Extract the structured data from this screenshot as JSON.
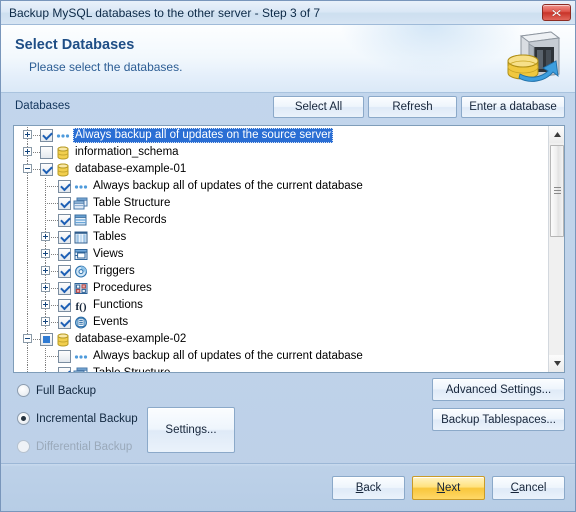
{
  "window": {
    "title": "Backup MySQL databases to the other server - Step 3 of 7",
    "close_icon": "close-icon"
  },
  "header": {
    "title": "Select Databases",
    "subtitle": "Please select the databases.",
    "icon": "database-backup-icon"
  },
  "toolbar": {
    "databases_label": "Databases",
    "select_all_label": "Select All",
    "refresh_label": "Refresh",
    "enter_database_label": "Enter a database"
  },
  "tree": {
    "rows": [
      {
        "label": "Always backup all of updates on the source server",
        "indent": 0,
        "expander": "plus",
        "check": "checked",
        "icon": "dots-icon",
        "selected": true
      },
      {
        "label": "information_schema",
        "indent": 0,
        "expander": "plus",
        "check": "unchecked",
        "icon": "database-icon",
        "selected": false
      },
      {
        "label": "database-example-01",
        "indent": 0,
        "expander": "minus",
        "check": "checked",
        "icon": "database-icon",
        "selected": false
      },
      {
        "label": "Always backup all of updates of the current database",
        "indent": 1,
        "expander": "none",
        "check": "checked",
        "icon": "dots-icon",
        "selected": false
      },
      {
        "label": "Table Structure",
        "indent": 1,
        "expander": "none",
        "check": "checked",
        "icon": "table-structure-icon",
        "selected": false
      },
      {
        "label": "Table Records",
        "indent": 1,
        "expander": "none",
        "check": "checked",
        "icon": "table-records-icon",
        "selected": false
      },
      {
        "label": "Tables",
        "indent": 1,
        "expander": "plus",
        "check": "checked",
        "icon": "tables-icon",
        "selected": false
      },
      {
        "label": "Views",
        "indent": 1,
        "expander": "plus",
        "check": "checked",
        "icon": "views-icon",
        "selected": false
      },
      {
        "label": "Triggers",
        "indent": 1,
        "expander": "plus",
        "check": "checked",
        "icon": "triggers-icon",
        "selected": false
      },
      {
        "label": "Procedures",
        "indent": 1,
        "expander": "plus",
        "check": "checked",
        "icon": "procedures-icon",
        "selected": false
      },
      {
        "label": "Functions",
        "indent": 1,
        "expander": "plus",
        "check": "checked",
        "icon": "functions-icon",
        "selected": false
      },
      {
        "label": "Events",
        "indent": 1,
        "expander": "plus",
        "check": "checked",
        "icon": "events-icon",
        "selected": false
      },
      {
        "label": "database-example-02",
        "indent": 0,
        "expander": "minus",
        "check": "partial",
        "icon": "database-icon",
        "selected": false
      },
      {
        "label": "Always backup all of updates of the current database",
        "indent": 1,
        "expander": "none",
        "check": "unchecked",
        "icon": "dots-icon",
        "selected": false
      },
      {
        "label": "Table Structure",
        "indent": 1,
        "expander": "none",
        "check": "checked",
        "icon": "table-structure-icon",
        "selected": false
      }
    ],
    "scrollbar": {
      "up_icon": "scroll-up-arrow-icon",
      "down_icon": "scroll-down-arrow-icon"
    }
  },
  "options": {
    "full_backup_label": "Full Backup",
    "incremental_backup_label": "Incremental Backup",
    "differential_backup_label": "Differential Backup",
    "selected": "Incremental Backup",
    "settings_label": "Settings...",
    "advanced_settings_label": "Advanced Settings...",
    "backup_tablespaces_label": "Backup Tablespaces..."
  },
  "footer": {
    "back_label": "Back",
    "back_accel": "B",
    "next_label": "Next",
    "next_accel": "N",
    "cancel_label": "Cancel",
    "cancel_accel": "C"
  },
  "colors": {
    "selection_blue": "#2a6ed4",
    "next_accent": "#f8c63c",
    "close_red": "#c83429",
    "header_title": "#1f4e86"
  }
}
